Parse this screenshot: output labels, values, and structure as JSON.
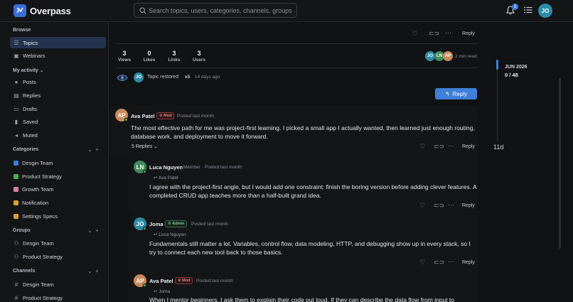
{
  "app": {
    "name": "Overpass"
  },
  "search": {
    "placeholder": "Search topics, users, categories, channels, groups"
  },
  "header": {
    "notification_count": "3",
    "user_initials": "JO"
  },
  "sidebar": {
    "browse_label": "Browse",
    "browse_items": [
      {
        "label": "Topics",
        "icon": "list-icon"
      },
      {
        "label": "Webinars",
        "icon": "webinar-icon"
      }
    ],
    "my_activity_label": "My activity",
    "activity_items": [
      {
        "label": "Posts",
        "icon": "person-icon"
      },
      {
        "label": "Replies",
        "icon": "reply-icon"
      },
      {
        "label": "Drafts",
        "icon": "draft-icon"
      },
      {
        "label": "Saved",
        "icon": "bookmark-icon"
      },
      {
        "label": "Muted",
        "icon": "mute-icon"
      }
    ],
    "categories_label": "Categories",
    "categories": [
      {
        "label": "Desgin Team",
        "color": "#3a7bd5"
      },
      {
        "label": "Product Strategy",
        "color": "#4caf50"
      },
      {
        "label": "Growth Team",
        "color": "#d77fa1"
      },
      {
        "label": "Notification",
        "color": "#e0a030"
      },
      {
        "label": "Settings Specs",
        "color": "#e0a030"
      }
    ],
    "groups_label": "Groups",
    "groups": [
      {
        "label": "Desgin Team"
      },
      {
        "label": "Product Strategy"
      }
    ],
    "channels_label": "Channels",
    "channels": [
      {
        "label": "Desgin Team"
      },
      {
        "label": "Product Strategy"
      }
    ]
  },
  "topic": {
    "reply_label": "Reply",
    "stats": [
      {
        "num": "3",
        "label": "Views"
      },
      {
        "num": "0",
        "label": "Likes"
      },
      {
        "num": "3",
        "label": "Links"
      },
      {
        "num": "3",
        "label": "Users"
      }
    ],
    "participants": [
      "JO",
      "LN",
      "AP"
    ],
    "read_time": "2 min read",
    "event_initials": "JO",
    "event_text": "Topic restored",
    "event_count": "x5",
    "event_time": "14 days ago",
    "reply_button": "Reply"
  },
  "posts": [
    {
      "initials": "AP",
      "avatar_color": "#c98a5a",
      "author": "Ava Patel",
      "badge": "Mod",
      "meta": "Posted last month",
      "body": "The most effective path for me was project-first learning. I picked a small app I actually wanted, then learned just enough routing, database work, and deployment to move it forward.",
      "replies_label": "5 Replies",
      "reply_label": "Reply"
    },
    {
      "initials": "LN",
      "avatar_color": "#3f8c5a",
      "author": "Luca Nguyen",
      "role": "Member",
      "meta": "Posted last month",
      "reply_to": "Ava Patel",
      "body": "I agree with the project-first angle, but I would add one constraint: finish the boring version before adding clever features. A completed CRUD app teaches more than a half-built grand idea.",
      "reply_label": "Reply"
    },
    {
      "initials": "JO",
      "avatar_color": "#2e8aa6",
      "author": "Joma",
      "badge": "Admin",
      "meta": "Posted last month",
      "reply_to": "Luca Nguyen",
      "body": "Fundamentals still matter a lot. Variables, control flow, data modeling, HTTP, and debugging show up in every stack, so I try to connect each new tool back to those basics.",
      "reply_label": "Reply"
    },
    {
      "initials": "AP",
      "avatar_color": "#c98a5a",
      "author": "Ava Patel",
      "badge": "Mod",
      "meta": "Posted last month",
      "reply_to": "Joma",
      "body": "When I mentor beginners, I ask them to explain their code out loud. If they can describe the data flow from input to"
    }
  ],
  "timeline": {
    "date": "JUN 2026",
    "count": "0 / 48",
    "ago": "11d"
  }
}
